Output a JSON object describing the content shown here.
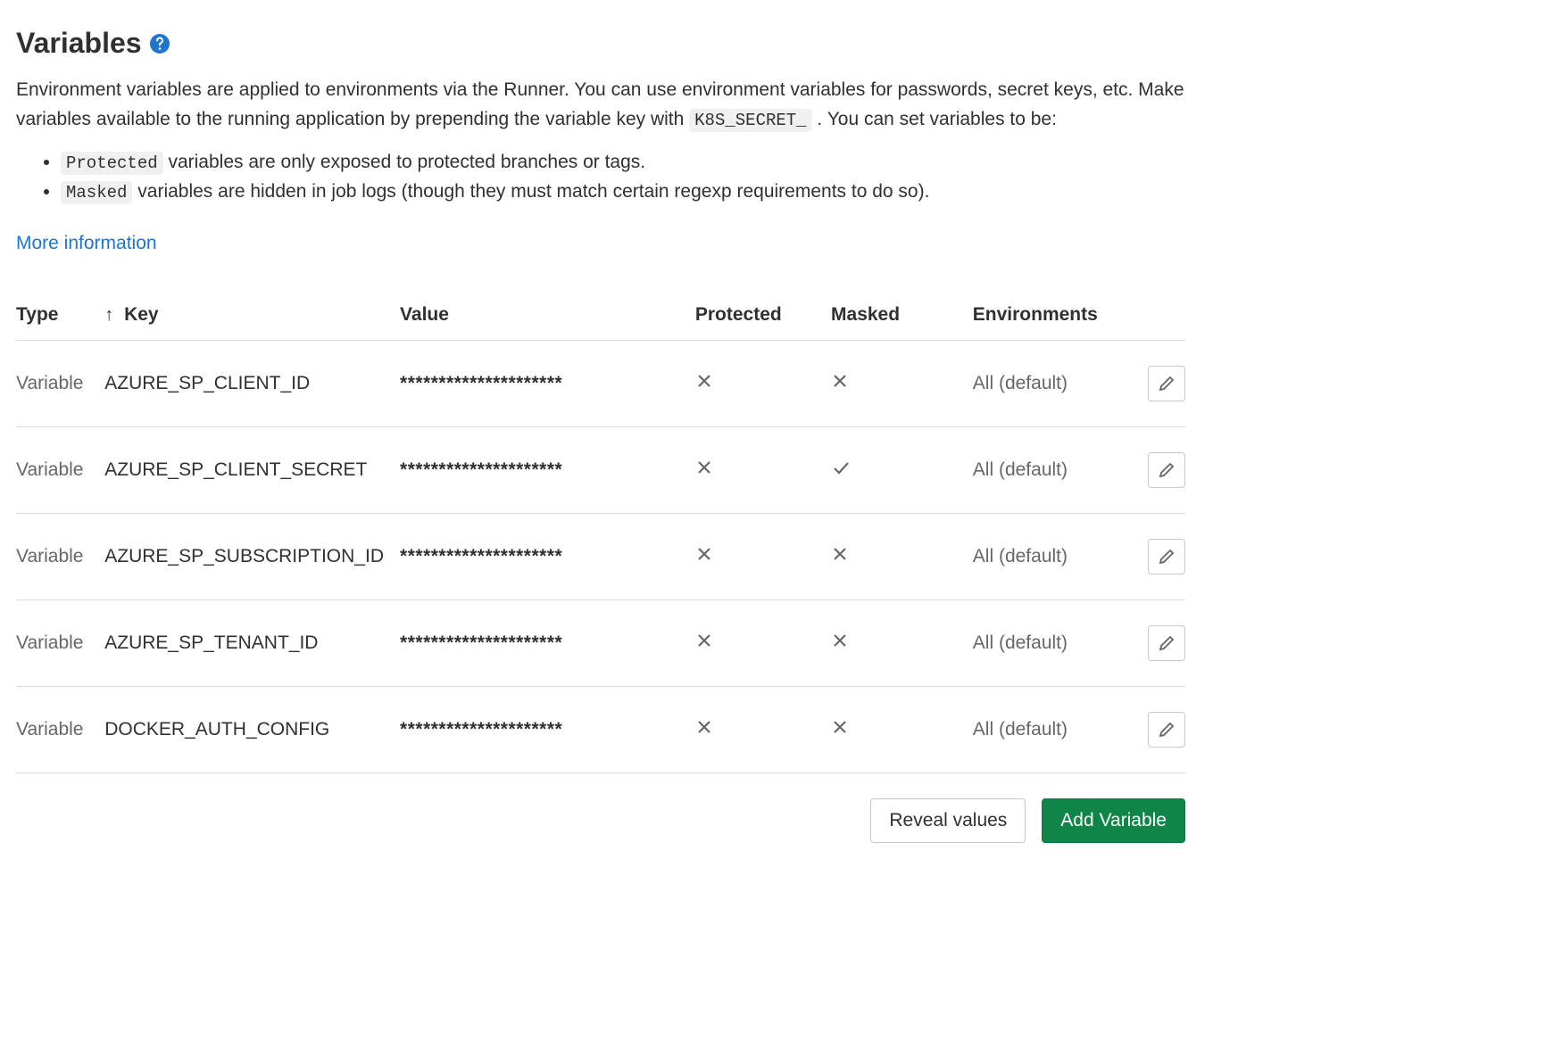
{
  "title": "Variables",
  "description_parts": {
    "p1": "Environment variables are applied to environments via the Runner. You can use environment variables for passwords, secret keys, etc. Make variables available to the running application by prepending the variable key with ",
    "code1": "K8S_SECRET_",
    "p2": ". You can set variables to be:"
  },
  "bullets": {
    "b1_code": "Protected",
    "b1_text": " variables are only exposed to protected branches or tags.",
    "b2_code": "Masked",
    "b2_text": " variables are hidden in job logs (though they must match certain regexp requirements to do so)."
  },
  "more_info": "More information",
  "table": {
    "headers": {
      "type": "Type",
      "key": "Key",
      "value": "Value",
      "protected": "Protected",
      "masked": "Masked",
      "environments": "Environments"
    },
    "rows": [
      {
        "type": "Variable",
        "key": "AZURE_SP_CLIENT_ID",
        "value": "*********************",
        "protected": false,
        "masked": false,
        "environments": "All (default)"
      },
      {
        "type": "Variable",
        "key": "AZURE_SP_CLIENT_SECRET",
        "value": "*********************",
        "protected": false,
        "masked": true,
        "environments": "All (default)"
      },
      {
        "type": "Variable",
        "key": "AZURE_SP_SUBSCRIPTION_ID",
        "value": "*********************",
        "protected": false,
        "masked": false,
        "environments": "All (default)"
      },
      {
        "type": "Variable",
        "key": "AZURE_SP_TENANT_ID",
        "value": "*********************",
        "protected": false,
        "masked": false,
        "environments": "All (default)"
      },
      {
        "type": "Variable",
        "key": "DOCKER_AUTH_CONFIG",
        "value": "*********************",
        "protected": false,
        "masked": false,
        "environments": "All (default)"
      }
    ]
  },
  "buttons": {
    "reveal": "Reveal values",
    "add": "Add Variable"
  }
}
